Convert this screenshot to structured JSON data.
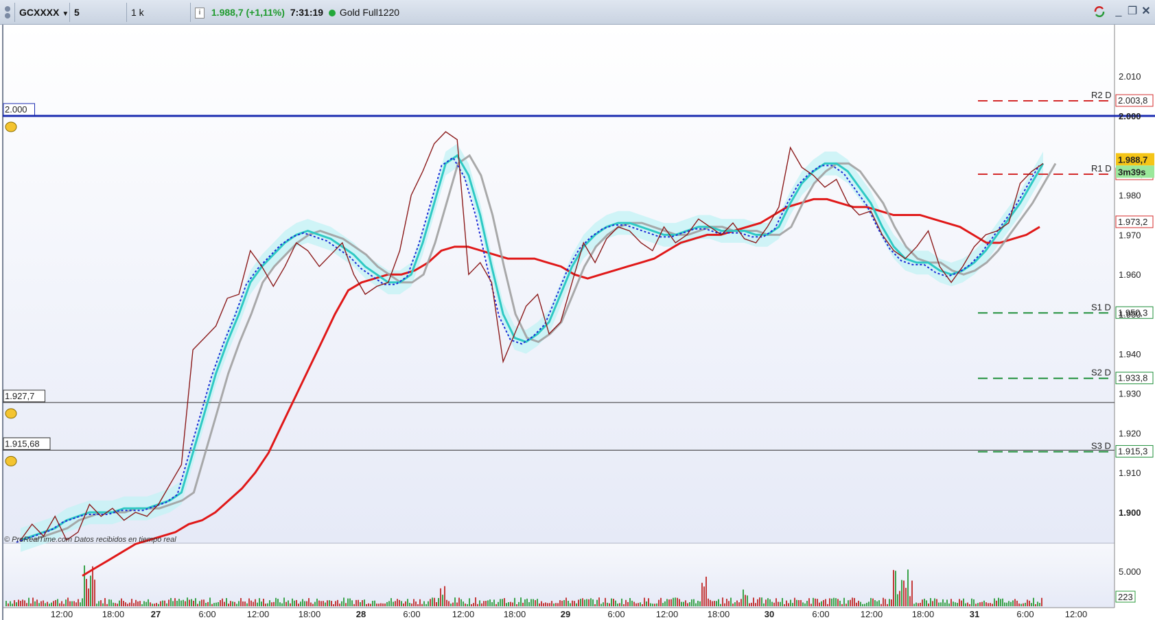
{
  "toolbar": {
    "menu_icon": "settings-grid-icon",
    "symbol": "GCXXXX",
    "timeframe": "5 minutos",
    "units": "1 k unidades",
    "info_icon": "info-icon",
    "price_change": "1.988,7 (+1,11%)",
    "clock": "7:31:19",
    "market_status_color": "#22a83a",
    "instrument": "Gold Full1220",
    "window_buttons": [
      "sync-icon",
      "minimize-icon",
      "restore-icon",
      "close-icon"
    ]
  },
  "price_axis": {
    "ticks": [
      "2.010",
      "2.000",
      "1.980",
      "1.970",
      "1.960",
      "1.950",
      "1.940",
      "1.930",
      "1.920",
      "1.910",
      "1.900"
    ],
    "current_price": "1.988,7",
    "countdown": "3m39s"
  },
  "pivots": [
    {
      "name": "R2 D",
      "label": "2.003,8",
      "value": 2003.8,
      "color": "#d42a2a"
    },
    {
      "name": "R1 D",
      "label": "1.985,3",
      "value": 1985.3,
      "color": "#d42a2a"
    },
    {
      "name": "",
      "label": "1.973,2",
      "value": 1973.2,
      "color": "#d42a2a"
    },
    {
      "name": "S1 D",
      "label": "1.950,3",
      "value": 1950.3,
      "color": "#1f8f3a"
    },
    {
      "name": "S2 D",
      "label": "1.933,8",
      "value": 1933.8,
      "color": "#1f8f3a"
    },
    {
      "name": "S3 D",
      "label": "1.915,3",
      "value": 1915.3,
      "color": "#1f8f3a"
    }
  ],
  "alerts": [
    {
      "label": "2.000",
      "value": 2000,
      "color": "#1a2bb0",
      "icon": "bell-icon"
    },
    {
      "label": "1.927,7",
      "value": 1927.7,
      "color": "#333333",
      "icon": "bell-icon"
    },
    {
      "label": "1.915,68",
      "value": 1915.68,
      "color": "#333333",
      "icon": "bell-icon"
    }
  ],
  "footer_note": "© ProRealTime.com  Datos recibidos en tiempo real",
  "volume_axis": {
    "tick": "5.000",
    "current": "223"
  },
  "time_axis": [
    "12:00",
    "18:00",
    "27",
    "6:00",
    "12:00",
    "18:00",
    "28",
    "6:00",
    "12:00",
    "18:00",
    "29",
    "6:00",
    "12:00",
    "18:00",
    "30",
    "6:00",
    "12:00",
    "18:00",
    "31",
    "6:00",
    "12:00"
  ],
  "colors": {
    "price_line": "#8b1a1a",
    "ma_cyan": "#2ec9c4",
    "ma_gray": "#a0a0a0",
    "ma_red": "#e01818",
    "ma_dotted": "#1c2bd6",
    "cloud": "#c5f3f5",
    "plot_bg_top": "#ffffff",
    "plot_bg_bottom": "#e6eaf7"
  },
  "chart_data": {
    "type": "line",
    "title": "",
    "ylim": [
      1891,
      2014
    ],
    "x_ticks": [
      "12:00",
      "18:00",
      "27",
      "6:00",
      "12:00",
      "18:00",
      "28",
      "6:00",
      "12:00",
      "18:00",
      "29",
      "6:00",
      "12:00",
      "18:00",
      "30",
      "6:00",
      "12:00",
      "18:00",
      "31",
      "6:00",
      "12:00"
    ],
    "series": [
      {
        "values": [
          1893,
          1897,
          1894,
          1899,
          1893,
          1895,
          1902,
          1899,
          1901,
          1898,
          1900,
          1899,
          1902,
          1907,
          1912,
          1941,
          1944,
          1947,
          1954,
          1955,
          1966,
          1962,
          1957,
          1962,
          1968,
          1966,
          1962,
          1965,
          1968,
          1960,
          1955,
          1957,
          1958,
          1966,
          1980,
          1986,
          1993,
          1996,
          1994,
          1960,
          1963,
          1958,
          1938,
          1945,
          1952,
          1955,
          1945,
          1948,
          1958,
          1968,
          1963,
          1969,
          1972,
          1971,
          1968,
          1966,
          1972,
          1968,
          1970,
          1974,
          1972,
          1970,
          1973,
          1969,
          1968,
          1972,
          1977,
          1992,
          1987,
          1985,
          1982,
          1984,
          1978,
          1975,
          1976,
          1970,
          1966,
          1964,
          1967,
          1971,
          1962,
          1958,
          1962,
          1967,
          1970,
          1971,
          1973,
          1983,
          1986,
          1988
        ]
      },
      {
        "values": [
          1893,
          1894,
          1895,
          1896,
          1898,
          1899,
          1900,
          1900,
          1900,
          1901,
          1901,
          1901,
          1902,
          1903,
          1905,
          1915,
          1925,
          1935,
          1943,
          1950,
          1958,
          1962,
          1965,
          1968,
          1970,
          1971,
          1970,
          1969,
          1967,
          1965,
          1962,
          1960,
          1958,
          1958,
          1960,
          1968,
          1978,
          1988,
          1990,
          1985,
          1975,
          1962,
          1950,
          1944,
          1943,
          1945,
          1948,
          1955,
          1962,
          1967,
          1970,
          1972,
          1973,
          1973,
          1972,
          1971,
          1970,
          1970,
          1971,
          1972,
          1972,
          1971,
          1971,
          1971,
          1970,
          1970,
          1972,
          1978,
          1983,
          1986,
          1988,
          1988,
          1986,
          1982,
          1978,
          1972,
          1967,
          1964,
          1963,
          1963,
          1961,
          1960,
          1961,
          1963,
          1966,
          1970,
          1974,
          1978,
          1983,
          1988
        ]
      },
      {
        "values": [
          1884,
          1886,
          1888,
          1890,
          1892,
          1893,
          1894,
          1895,
          1897,
          1898,
          1900,
          1903,
          1906,
          1910,
          1915,
          1922,
          1929,
          1936,
          1943,
          1950,
          1956,
          1958,
          1959,
          1960,
          1960,
          1961,
          1963,
          1966,
          1967,
          1967,
          1966,
          1965,
          1964,
          1964,
          1964,
          1963,
          1962,
          1960,
          1959,
          1960,
          1961,
          1962,
          1963,
          1964,
          1966,
          1968,
          1969,
          1970,
          1970,
          1971,
          1972,
          1973,
          1975,
          1977,
          1978,
          1979,
          1979,
          1978,
          1977,
          1977,
          1976,
          1975,
          1975,
          1975,
          1974,
          1973,
          1972,
          1970,
          1968,
          1968,
          1969,
          1970,
          1972
        ]
      }
    ]
  }
}
